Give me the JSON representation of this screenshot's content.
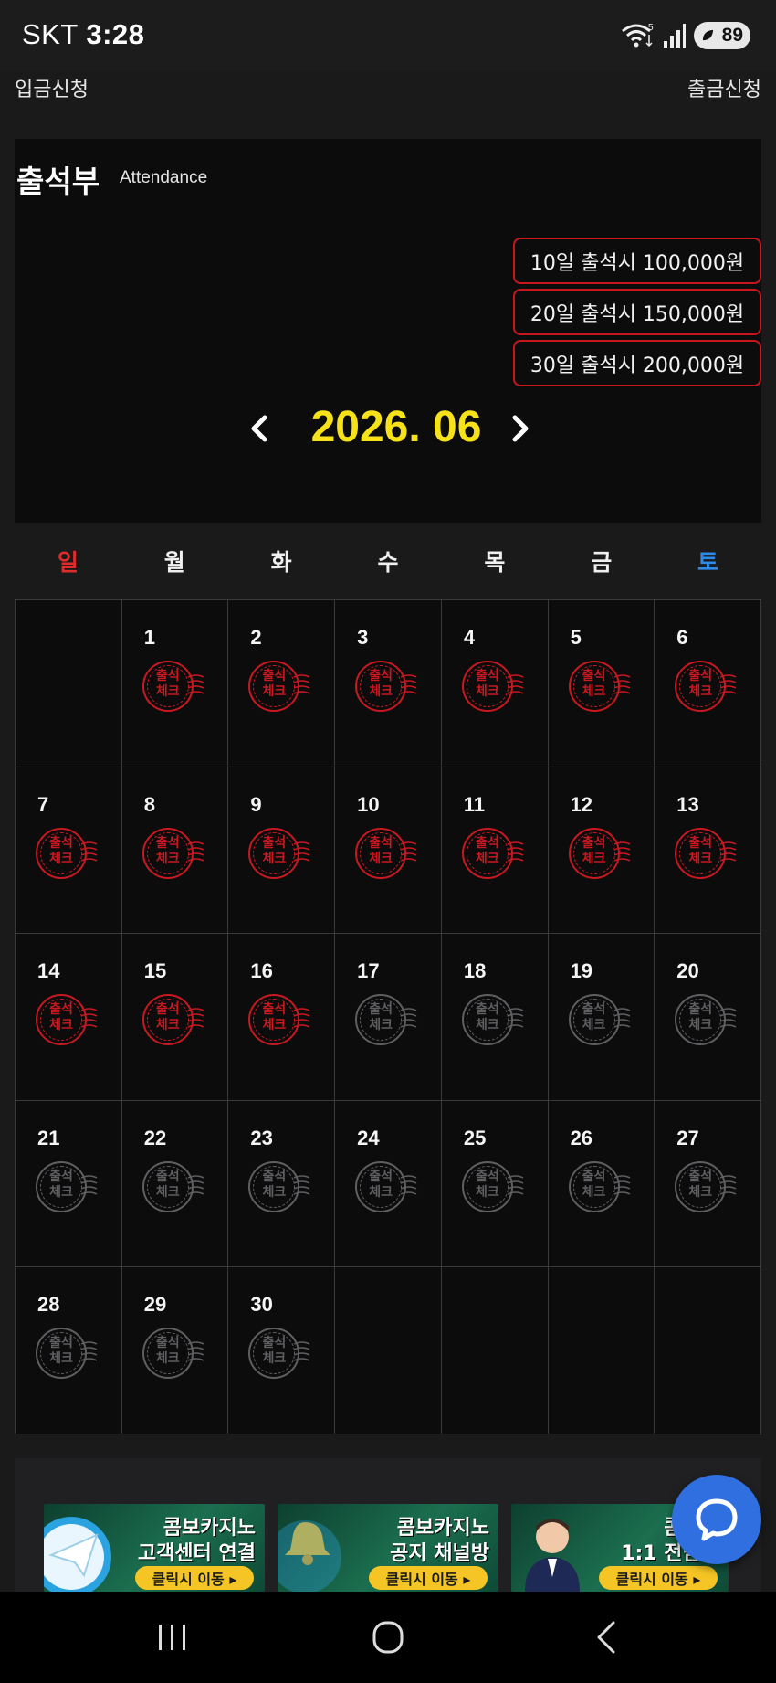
{
  "status_bar": {
    "carrier": "SKT",
    "time": "3:28",
    "battery": "89",
    "wifi_badge": "5"
  },
  "top_links": {
    "deposit": "입금신청",
    "withdraw": "출금신청"
  },
  "attendance": {
    "title": "출석부",
    "subtitle": "Attendance",
    "rewards": [
      "10일 출석시 100,000원",
      "20일 출석시 150,000원",
      "30일 출석시 200,000원"
    ],
    "month": "2026. 06"
  },
  "weekdays": [
    "일",
    "월",
    "화",
    "수",
    "목",
    "금",
    "토"
  ],
  "stamp_text": {
    "line1": "출석",
    "line2": "체크"
  },
  "calendar": {
    "leading_blank": 1,
    "days": [
      {
        "day": "1",
        "checked": true
      },
      {
        "day": "2",
        "checked": true
      },
      {
        "day": "3",
        "checked": true
      },
      {
        "day": "4",
        "checked": true
      },
      {
        "day": "5",
        "checked": true
      },
      {
        "day": "6",
        "checked": true
      },
      {
        "day": "7",
        "checked": true
      },
      {
        "day": "8",
        "checked": true
      },
      {
        "day": "9",
        "checked": true
      },
      {
        "day": "10",
        "checked": true
      },
      {
        "day": "11",
        "checked": true
      },
      {
        "day": "12",
        "checked": true
      },
      {
        "day": "13",
        "checked": true
      },
      {
        "day": "14",
        "checked": true
      },
      {
        "day": "15",
        "checked": true
      },
      {
        "day": "16",
        "checked": true
      },
      {
        "day": "17",
        "checked": false
      },
      {
        "day": "18",
        "checked": false
      },
      {
        "day": "19",
        "checked": false
      },
      {
        "day": "20",
        "checked": false
      },
      {
        "day": "21",
        "checked": false
      },
      {
        "day": "22",
        "checked": false
      },
      {
        "day": "23",
        "checked": false
      },
      {
        "day": "24",
        "checked": false
      },
      {
        "day": "25",
        "checked": false
      },
      {
        "day": "26",
        "checked": false
      },
      {
        "day": "27",
        "checked": false
      },
      {
        "day": "28",
        "checked": false
      },
      {
        "day": "29",
        "checked": false
      },
      {
        "day": "30",
        "checked": false
      }
    ]
  },
  "banners": [
    {
      "line1": "콤보카지노",
      "line2": "고객센터 연결",
      "button": "클릭시 이동 ▸",
      "icon": "telegram-icon"
    },
    {
      "line1": "콤보카지노",
      "line2": "공지 채널방",
      "button": "클릭시 이동 ▸",
      "icon": "bell-icon"
    },
    {
      "line1": "콤보카",
      "line2": "1:1 전담케",
      "button": "클릭시 이동 ▸",
      "icon": "agent-avatar-icon"
    }
  ],
  "colors": {
    "accent_yellow": "#f7e21a",
    "stamp_red": "#c81820",
    "sunday_red": "#e02b2b",
    "saturday_blue": "#2e8ae6",
    "chat_blue": "#2f6fe0"
  }
}
